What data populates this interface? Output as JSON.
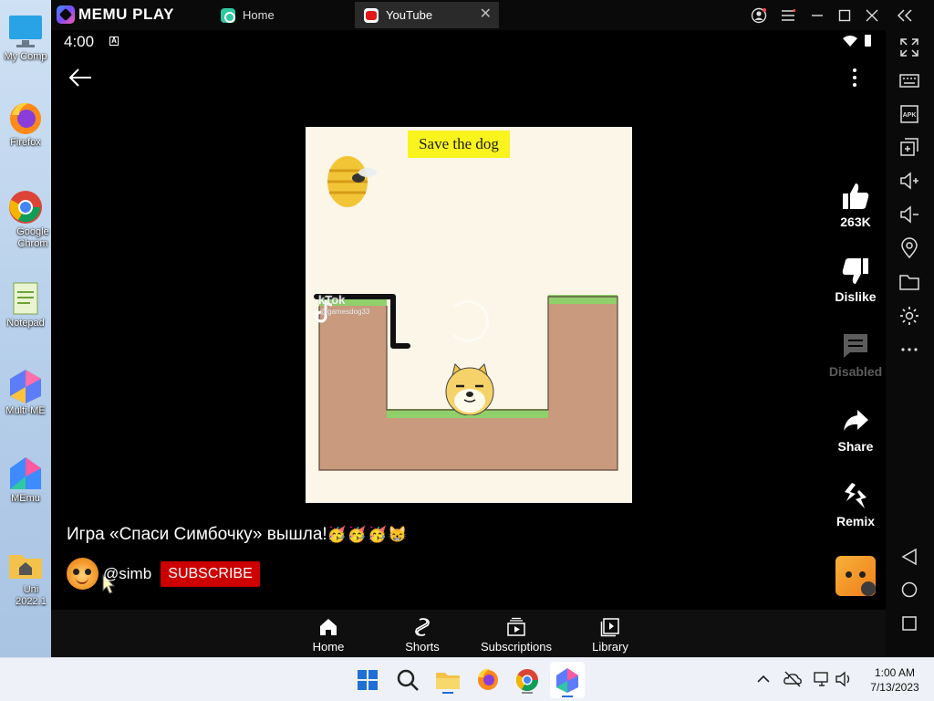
{
  "desktop": {
    "icons": [
      {
        "label": "My Comp"
      },
      {
        "label": "Firefox"
      },
      {
        "label": "Google Chrom"
      },
      {
        "label": "Notepad"
      },
      {
        "label": "Multi-ME"
      },
      {
        "label": "MEmu"
      },
      {
        "label": "Uni 2022.1"
      }
    ],
    "watermark_edge": "w 2"
  },
  "memu": {
    "brand": "MEMU PLAY",
    "tabs": [
      {
        "label": "Home"
      },
      {
        "label": "YouTube",
        "close": "✕"
      }
    ],
    "window_controls": [
      "account-icon",
      "menu-icon",
      "minimize-icon",
      "maximize-icon",
      "close-icon",
      "collapse-icon"
    ]
  },
  "status_bar": {
    "time": "4:00",
    "notification_badge": "A"
  },
  "video": {
    "title_banner": "Save the dog",
    "watermark": "kTok",
    "watermark_user": "@gamesdog33"
  },
  "actions": {
    "like_count": "263K",
    "dislike": "Dislike",
    "comments": "Disabled",
    "share": "Share",
    "remix": "Remix"
  },
  "caption": {
    "text": "Игра «Спаси Симбочку» вышла!",
    "emojis": "🥳🥳🥳😸"
  },
  "channel": {
    "handle": "@simb",
    "subscribe_label": "SUBSCRIBE"
  },
  "bottom_nav": [
    {
      "label": "Home"
    },
    {
      "label": "Shorts"
    },
    {
      "label": "Subscriptions"
    },
    {
      "label": "Library"
    }
  ],
  "taskbar": {
    "time": "1:00 AM",
    "date": "7/13/2023"
  },
  "colors": {
    "subscribe": "#cc0000",
    "banner": "#f9f41e",
    "grass": "#8fd06a",
    "dirt": "#c99a7d"
  }
}
